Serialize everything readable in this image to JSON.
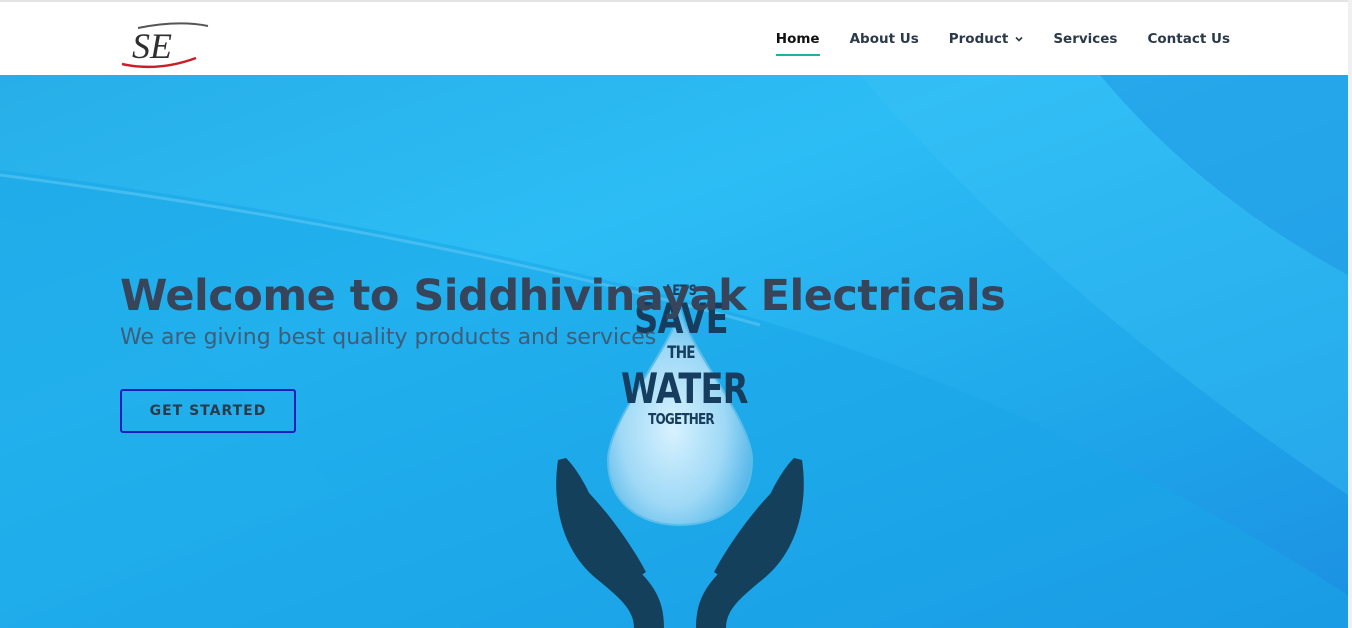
{
  "logo": {
    "text": "SE"
  },
  "nav": {
    "items": [
      {
        "label": "Home",
        "active": true
      },
      {
        "label": "About Us"
      },
      {
        "label": "Product",
        "has_dropdown": true
      },
      {
        "label": "Services"
      },
      {
        "label": "Contact Us"
      }
    ]
  },
  "hero": {
    "title": "Welcome to Siddhivinayak Electricals",
    "subtitle": "We are giving best quality products and services",
    "cta_label": "GET STARTED",
    "image_text": {
      "line1": "LET'S",
      "line2": "SAVE",
      "line3": "THE",
      "line4": "WATER",
      "line5": "TOGETHER"
    }
  },
  "colors": {
    "accent_underline": "#1bb1a3",
    "hero_blue": "#2dbdf5",
    "title_text": "#37445a",
    "cta_border": "#1a1fb8",
    "hands": "#14405c"
  }
}
